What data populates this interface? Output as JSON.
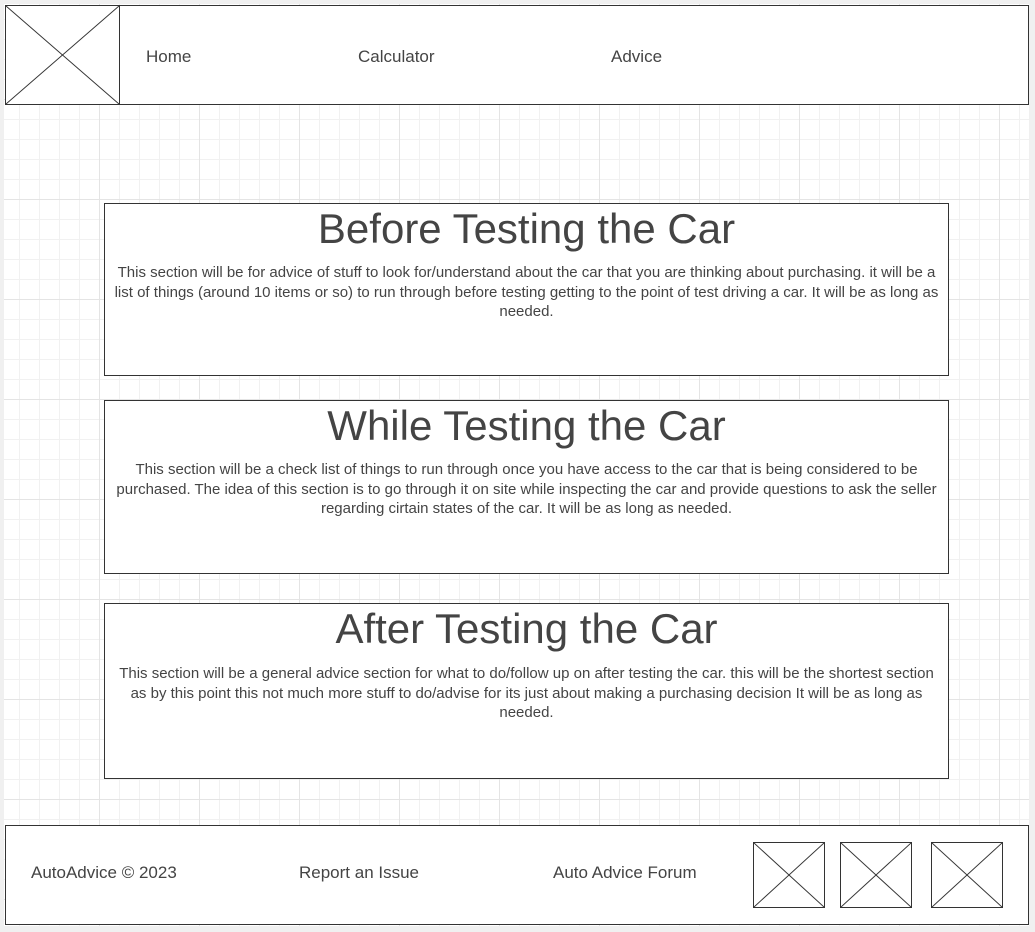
{
  "header": {
    "logo_icon": "image-placeholder-icon",
    "nav": [
      {
        "label": "Home"
      },
      {
        "label": "Calculator"
      },
      {
        "label": "Advice"
      }
    ]
  },
  "sections": [
    {
      "title": "Before Testing the Car",
      "body": "This section will be for advice of stuff to look for/understand about the car that you are thinking about purchasing. it will be a list of things (around 10 items or so) to run through before testing getting to the point of test driving a car. It will be as long as needed."
    },
    {
      "title": "While Testing the Car",
      "body": "This section will be a check list of things to run through once you have access to the car that is being considered to be purchased. The idea of this section is to go through it on site while inspecting the car and provide questions to ask the seller regarding cirtain states of the car. It will be as long as needed."
    },
    {
      "title": "After Testing the Car",
      "body": "This section will be a general advice section for what to do/follow up on after testing the car. this will be the shortest section as by this point this not much more stuff to do/advise for its just about making a purchasing decision It will be as long as needed."
    }
  ],
  "footer": {
    "copyright": "AutoAdvice © 2023",
    "report_link": "Report an Issue",
    "forum_link": "Auto Advice Forum",
    "social_icons": [
      "image-placeholder-icon",
      "image-placeholder-icon",
      "image-placeholder-icon"
    ]
  },
  "colors": {
    "text": "#444444",
    "border": "#333333",
    "background": "#ffffff",
    "grid": "#e4e4e4"
  }
}
